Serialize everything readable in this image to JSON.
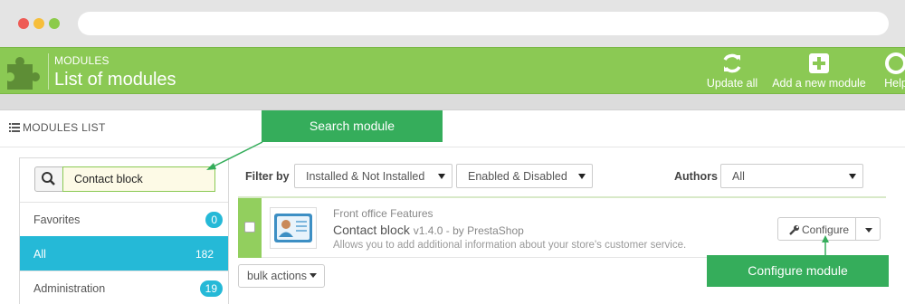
{
  "header": {
    "subtitle": "MODULES",
    "title": "List of modules",
    "toolbar": [
      {
        "label": "Update all",
        "icon": "refresh-icon"
      },
      {
        "label": "Add a new module",
        "icon": "plus-square-icon"
      },
      {
        "label": "Help",
        "icon": "lifebuoy-icon"
      }
    ]
  },
  "panel": {
    "heading": "MODULES LIST"
  },
  "sidebar": {
    "search_value": "Contact block",
    "items": [
      {
        "label": "Favorites",
        "count": "0",
        "active": false
      },
      {
        "label": "All",
        "count": "182",
        "active": true
      },
      {
        "label": "Administration",
        "count": "19",
        "active": false
      }
    ]
  },
  "filters": {
    "filter_by_label": "Filter by",
    "install_select": "Installed & Not Installed",
    "enable_select": "Enabled & Disabled",
    "authors_label": "Authors",
    "authors_select": "All"
  },
  "module": {
    "category": "Front office Features",
    "name": "Contact block",
    "version": "v1.4.0 - by PrestaShop",
    "description": "Allows you to add additional information about your store's customer service.",
    "configure_label": "Configure"
  },
  "bulk_actions_label": "bulk actions",
  "callouts": {
    "search": "Search module",
    "configure": "Configure module"
  },
  "colors": {
    "header_green": "#8bc954",
    "callout_green": "#35ad5b",
    "active_blue": "#25b9d7"
  }
}
